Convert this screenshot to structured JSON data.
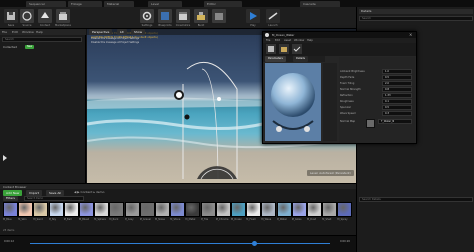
{
  "editor_tabs": [
    "Sequencer",
    "Foliage",
    "Material",
    "Level",
    "Editor",
    "Cascade"
  ],
  "toolbar": {
    "buttons": [
      "Save",
      "Source",
      "Content",
      "Marketplace",
      "Settings",
      "Blueprints",
      "Cinematics",
      "Build",
      "Play",
      "Launch"
    ]
  },
  "left_panel": {
    "menu": [
      "File",
      "Edit",
      "Window",
      "Help"
    ],
    "search_placeholder": "Search",
    "tree_item": "Collected",
    "tree_badge": "New"
  },
  "viewport": {
    "header_text": "LIGHTING NEEDS TO BE REBUILT (6 unbuilt objects)",
    "header_sub": "Disable this message at Project Settings",
    "mode_buttons": [
      "Perspective",
      "Lit",
      "Show"
    ],
    "level_label": "Level: Autoforest (Persistent)"
  },
  "material_window": {
    "title": "M_Ocean_Water",
    "menu": [
      "File",
      "Edit",
      "Asset",
      "Window",
      "Help"
    ],
    "tabs": [
      "Parameters",
      "Details"
    ],
    "rows": [
      {
        "label": "Ambient Brightness",
        "value": "1.0"
      },
      {
        "label": "Depth Fade",
        "value": "0.5"
      },
      {
        "label": "Foam Tiling",
        "value": "2.0"
      },
      {
        "label": "Normal Strength",
        "value": "0.8"
      },
      {
        "label": "Refraction",
        "value": "1.33"
      },
      {
        "label": "Roughness",
        "value": "0.1"
      },
      {
        "label": "Specular",
        "value": "0.5"
      },
      {
        "label": "Wave Speed",
        "value": "0.3"
      },
      {
        "label": "Normal Map",
        "value": "T_Water_N"
      }
    ]
  },
  "right_panel": {
    "title": "Details",
    "search_placeholder": "Search",
    "search2_placeholder": "Search Details"
  },
  "content_browser": {
    "title": "Content Browser",
    "add_new": "Add New",
    "import": "Import",
    "save_all": "Save All",
    "breadcrumb_root": "Content",
    "breadcrumb_folder": "demo",
    "filters": "Filters",
    "search_placeholder": "Search Demo",
    "items": [
      "M_Blue",
      "M_Skin",
      "M_Sand",
      "M_Sky",
      "M_Ball",
      "M_Blue2",
      "M_Sphere",
      "M_Rock",
      "M_Grey",
      "M_Gravel",
      "M_Noise",
      "M_Stone",
      "M_Metal",
      "M_Tile",
      "M_Chrome",
      "M_Ocean",
      "M_Foam",
      "M_Wave",
      "M_Water",
      "M_Gloss",
      "M_Dust",
      "M_Shell",
      "M_Spray"
    ],
    "status": "23 items"
  },
  "timeline": {
    "time_left": "0:00:12",
    "time_right": "0:00:20"
  },
  "colors": {
    "accent_green": "#3aa33a",
    "play_blue": "#2f7fd6",
    "panel": "#1b1b1b"
  }
}
